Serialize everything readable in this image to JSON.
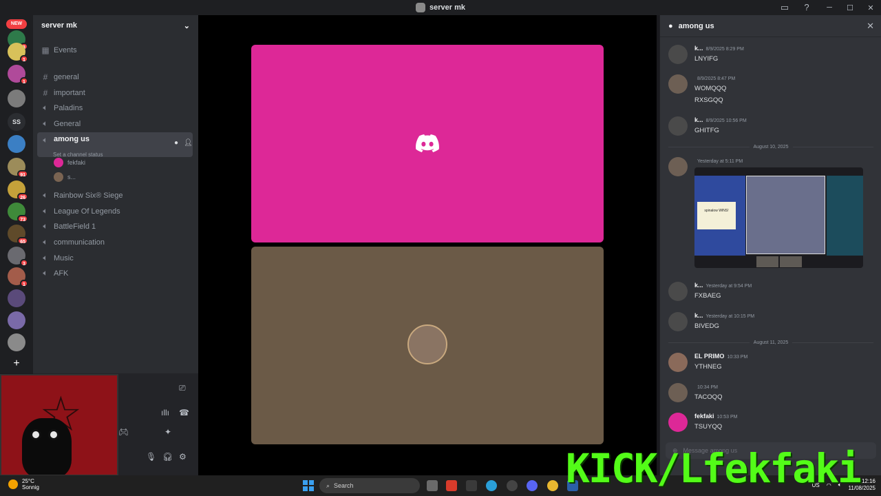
{
  "window": {
    "title": "server mk"
  },
  "rail": {
    "new_badge": "NEW",
    "ss_label": "SS",
    "badges": [
      "3",
      "1",
      "1",
      "91",
      "26",
      "73",
      "65",
      "3",
      "1"
    ]
  },
  "sidebar": {
    "server_name": "server mk",
    "events": "Events",
    "channels": [
      {
        "name": "general",
        "type": "text"
      },
      {
        "name": "important",
        "type": "text"
      },
      {
        "name": "Paladins",
        "type": "voice"
      },
      {
        "name": "General",
        "type": "voice"
      },
      {
        "name": "among us",
        "type": "voice",
        "active": true,
        "status": "Set a channel status"
      },
      {
        "name": "Rainbow Six® Siege",
        "type": "voice"
      },
      {
        "name": "League Of Legends",
        "type": "voice"
      },
      {
        "name": "BattleField 1",
        "type": "voice"
      },
      {
        "name": "communication",
        "type": "voice"
      },
      {
        "name": "Music",
        "type": "voice"
      },
      {
        "name": "AFK",
        "type": "voice"
      }
    ],
    "voice_users": [
      "fekfaki",
      "s..."
    ]
  },
  "chat": {
    "channel": "among us",
    "messages": [
      {
        "author": "k...",
        "time": "8/9/2025 8:29 PM",
        "lines": [
          "LNYIFG"
        ]
      },
      {
        "author": "",
        "time": "8/9/2025 8:47 PM",
        "lines": [
          "WOMQQQ",
          "RXSGQQ"
        ]
      },
      {
        "author": "k...",
        "time": "8/9/2025 10:56 PM",
        "lines": [
          "GHITFG"
        ]
      },
      {
        "author": "",
        "time": "Yesterday at 5:11 PM",
        "lines": []
      },
      {
        "author": "k...",
        "time": "Yesterday at 9:54 PM",
        "lines": [
          "FXBAEG"
        ]
      },
      {
        "author": "k...",
        "time": "Yesterday at 10:15 PM",
        "lines": [
          "BIVEDG"
        ]
      },
      {
        "author": "EL PRIMO",
        "time": "10:33 PM",
        "lines": [
          "YTHNEG"
        ]
      },
      {
        "author": "",
        "time": "10:34 PM",
        "lines": [
          "TACOQQ"
        ]
      },
      {
        "author": "fekfaki",
        "time": "10:53 PM",
        "lines": [
          "TSUYQQ"
        ]
      }
    ],
    "dividers": [
      "August 10, 2025",
      "August 11, 2025"
    ],
    "attachment_card_text": "spinalow WINS!",
    "composer_placeholder": "Message among us"
  },
  "taskbar": {
    "temp": "25°C",
    "weather": "Sonnig",
    "search": "Search",
    "lang": "US",
    "time": "12:16",
    "date": "11/08/2025"
  },
  "overlay": {
    "kick": "KICK/Lfekfaki"
  },
  "colors": {
    "pink_tile": "#dd2897",
    "brown_tile": "#6b5a47",
    "kick_green": "#53fc18",
    "discord_blurple": "#5865f2"
  }
}
